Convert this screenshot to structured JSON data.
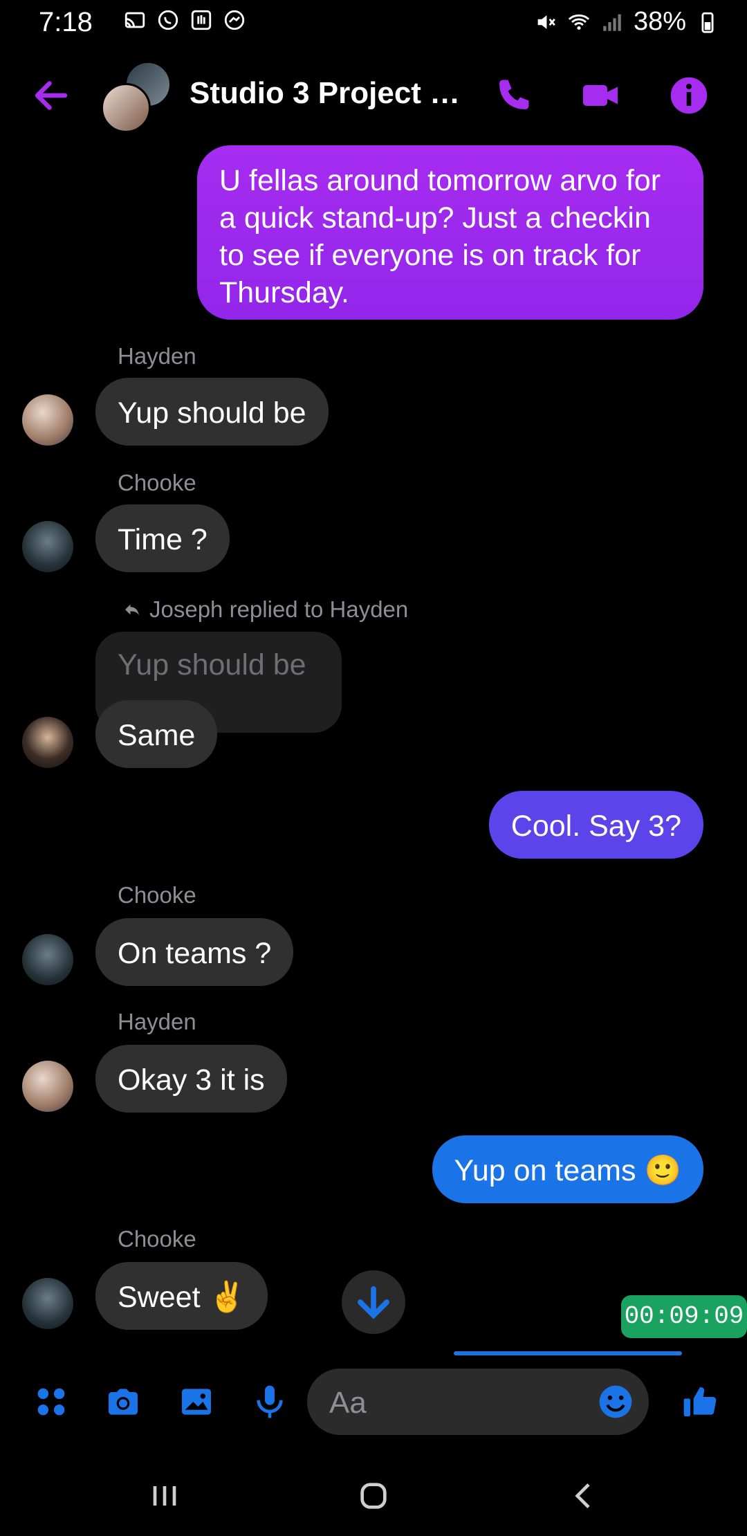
{
  "status_bar": {
    "time": "7:18",
    "battery": "38%"
  },
  "header": {
    "title": "Studio 3 Project T..."
  },
  "messages": [
    {
      "text": "U fellas around tomorrow arvo for a quick stand-up? Just a checkin to see if everyone is on track for Thursday."
    },
    {
      "sender": "Hayden",
      "text": "Yup should be"
    },
    {
      "sender": "Chooke",
      "text": "Time ?"
    },
    {
      "reply_label": "Joseph replied to Hayden",
      "quoted": "Yup should be",
      "text": "Same"
    },
    {
      "text": "Cool. Say 3?"
    },
    {
      "sender": "Chooke",
      "text": "On teams ?"
    },
    {
      "sender": "Hayden",
      "text": "Okay 3 it is"
    },
    {
      "text": "Yup on teams 🙂"
    },
    {
      "sender": "Chooke",
      "text": "Sweet ✌️"
    }
  ],
  "timer": "00:09:09",
  "composer": {
    "placeholder": "Aa"
  },
  "colors": {
    "accent_purple": "#a62cf0",
    "bubble_blue": "#1a74e8",
    "bubble_violet": "#5b44ea"
  }
}
